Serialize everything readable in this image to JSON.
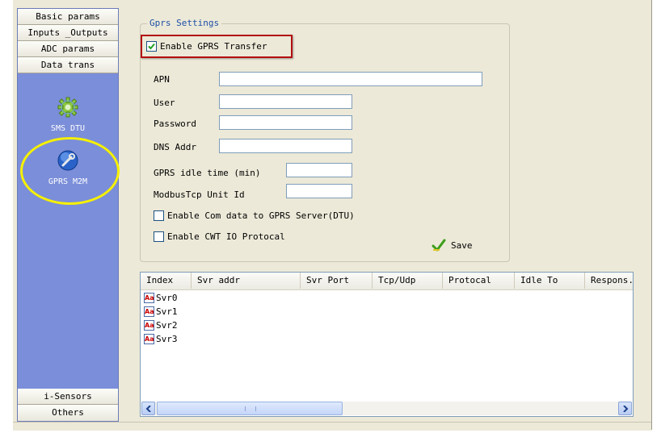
{
  "sidebar": {
    "top_buttons": [
      "Basic params",
      "Inputs _Outputs",
      "ADC params",
      "Data trans"
    ],
    "nav_items": [
      {
        "label": "SMS DTU",
        "icon": "gear-icon"
      },
      {
        "label": "GPRS M2M",
        "icon": "wrench-globe-icon"
      }
    ],
    "bottom_buttons": [
      "i-Sensors",
      "Others"
    ]
  },
  "gprs": {
    "group_title": "Gprs Settings",
    "enable_transfer": {
      "label": "Enable GPRS Transfer",
      "checked": true
    },
    "fields": {
      "apn": {
        "label": "APN",
        "value": ""
      },
      "user": {
        "label": "User",
        "value": ""
      },
      "password": {
        "label": "Password",
        "value": ""
      },
      "dns": {
        "label": "DNS Addr",
        "value": ""
      },
      "idle": {
        "label": "GPRS idle time (min)",
        "value": ""
      },
      "unit_id": {
        "label": "ModbusTcp Unit Id",
        "value": ""
      }
    },
    "enable_com": {
      "label": "Enable Com data to GPRS Server(DTU)",
      "checked": false
    },
    "enable_cwt": {
      "label": "Enable CWT IO Protocal",
      "checked": false
    },
    "save_label": "Save"
  },
  "servers": {
    "columns": [
      "Index",
      "Svr addr",
      "Svr Port",
      "Tcp/Udp",
      "Protocal",
      "Idle To",
      "Respons."
    ],
    "rows": [
      "Svr0",
      "Svr1",
      "Svr2",
      "Svr3"
    ]
  },
  "colors": {
    "sidebar_bg": "#7b8ed9",
    "highlight_red": "#b40d10",
    "highlight_yellow": "#f5f000",
    "group_title": "#1e4ea6"
  }
}
